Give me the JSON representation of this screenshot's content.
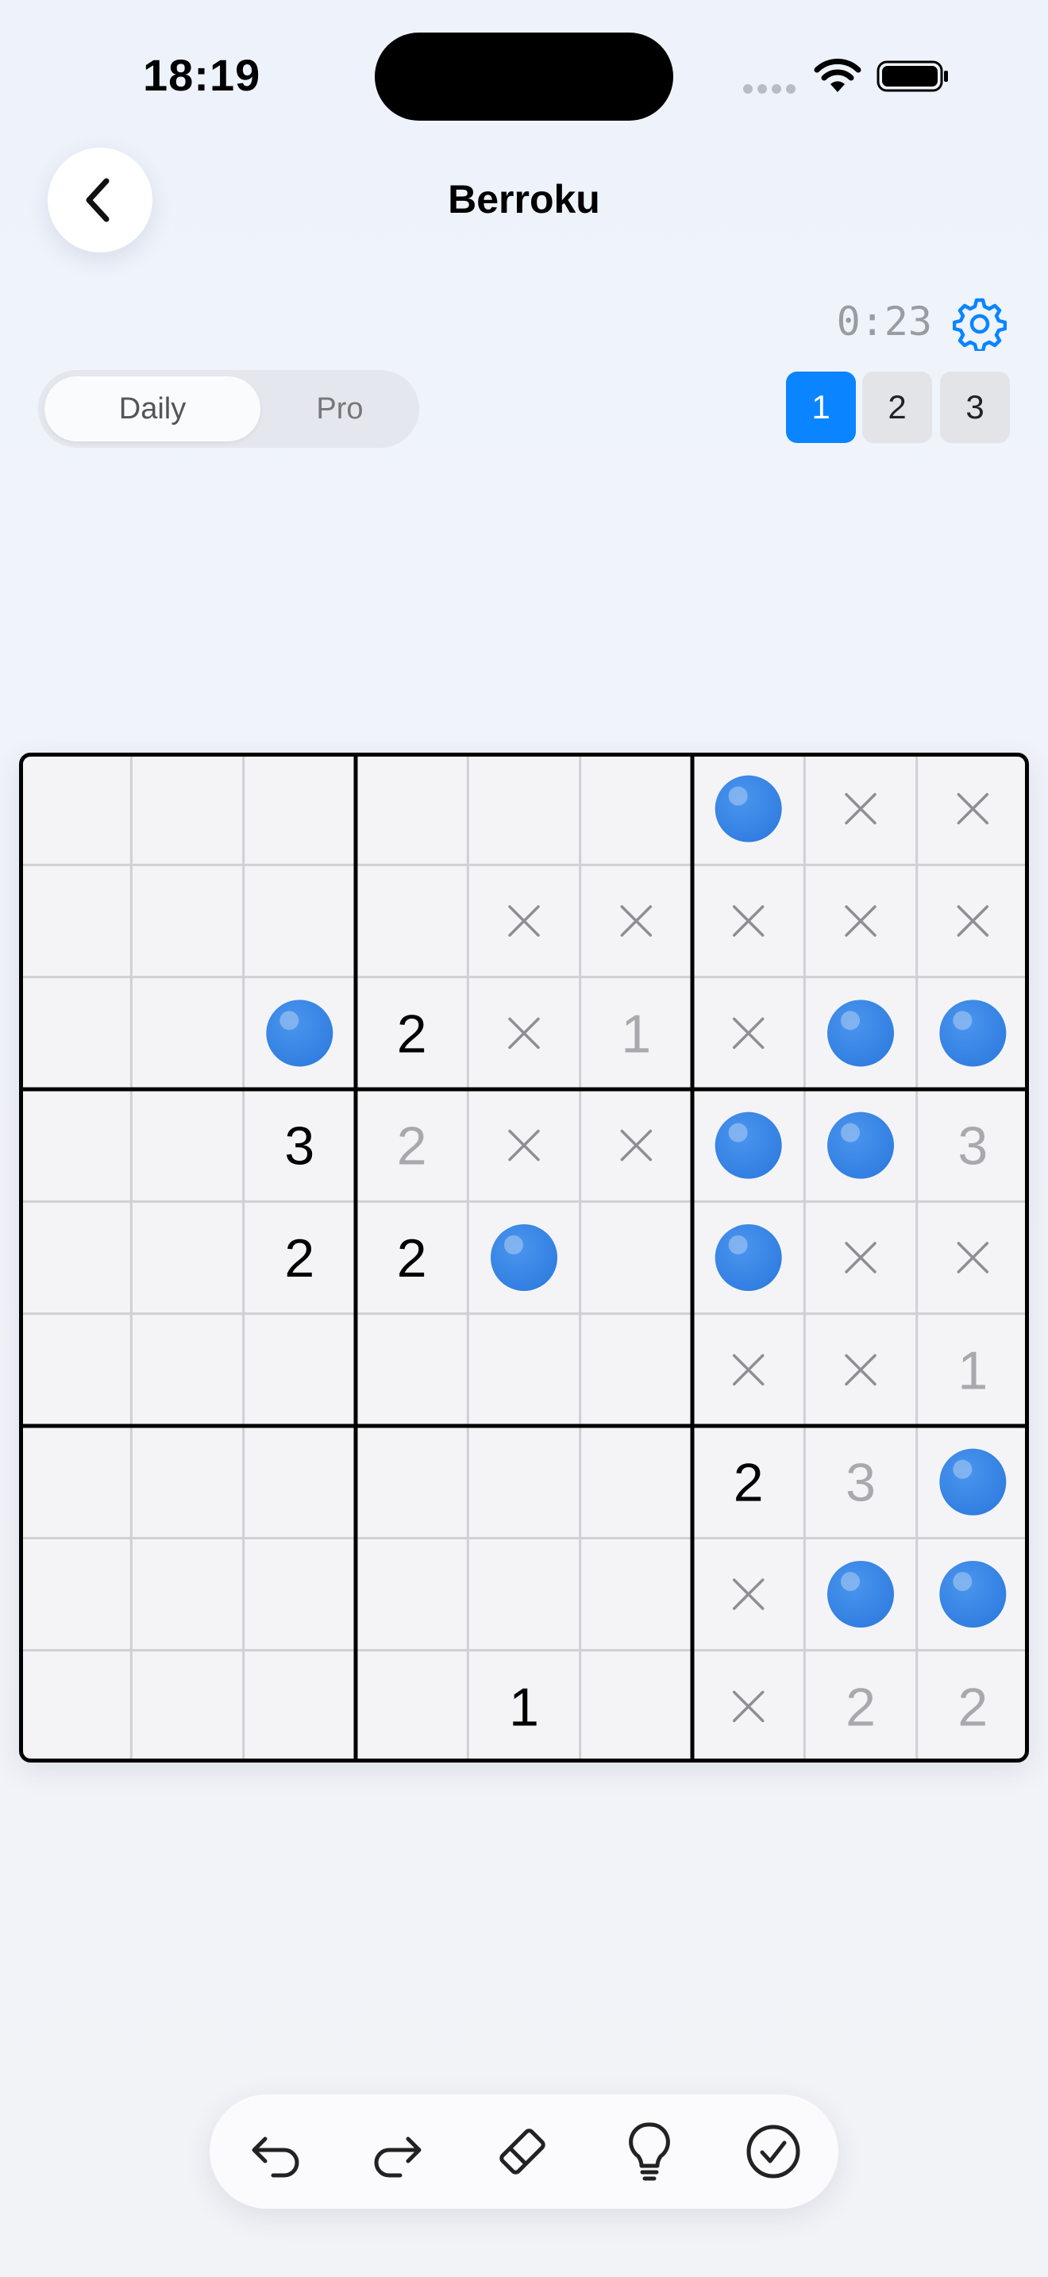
{
  "status_bar": {
    "time": "18:19"
  },
  "header": {
    "title": "Berroku",
    "back_icon": "chevron-left-icon"
  },
  "game": {
    "timer": "0:23",
    "settings_icon": "gear-icon"
  },
  "mode_toggle": {
    "options": [
      "Daily",
      "Pro"
    ],
    "selected": "Daily"
  },
  "levels": {
    "items": [
      "1",
      "2",
      "3"
    ],
    "selected": "1"
  },
  "colors": {
    "accent": "#0b84ff",
    "ball": "#2f7de0",
    "given_digit": "#000000",
    "entered_digit": "#a9a9ad",
    "mark": "#8e8e93",
    "cell_bg": "#f4f4f6",
    "grid_line": "#cfd0d4"
  },
  "board": {
    "size": 9,
    "legend": {
      "O": "ball",
      "X": "cross",
      "digit": "given number",
      "digit_g": "entered number (gray)"
    },
    "rows": [
      [
        "",
        "",
        "",
        "",
        "",
        "",
        "O",
        "X",
        "X"
      ],
      [
        "",
        "",
        "",
        "",
        "X",
        "X",
        "X",
        "X",
        "X"
      ],
      [
        "",
        "",
        "O",
        "2",
        "X",
        "1g",
        "X",
        "O",
        "O"
      ],
      [
        "",
        "",
        "3",
        "2g",
        "X",
        "X",
        "O",
        "O",
        "3g"
      ],
      [
        "",
        "",
        "2",
        "2",
        "O",
        "",
        "O",
        "X",
        "X"
      ],
      [
        "",
        "",
        "",
        "",
        "",
        "",
        "X",
        "X",
        "1g"
      ],
      [
        "",
        "",
        "",
        "",
        "",
        "",
        "2",
        "3g",
        "O"
      ],
      [
        "",
        "",
        "",
        "",
        "",
        "",
        "X",
        "O",
        "O"
      ],
      [
        "",
        "",
        "",
        "",
        "1",
        "",
        "X",
        "2g",
        "2g"
      ]
    ]
  },
  "toolbar": {
    "tools": [
      {
        "icon": "undo-icon"
      },
      {
        "icon": "redo-icon"
      },
      {
        "icon": "eraser-icon"
      },
      {
        "icon": "hint-lightbulb-icon"
      },
      {
        "icon": "check-circle-icon"
      }
    ]
  }
}
